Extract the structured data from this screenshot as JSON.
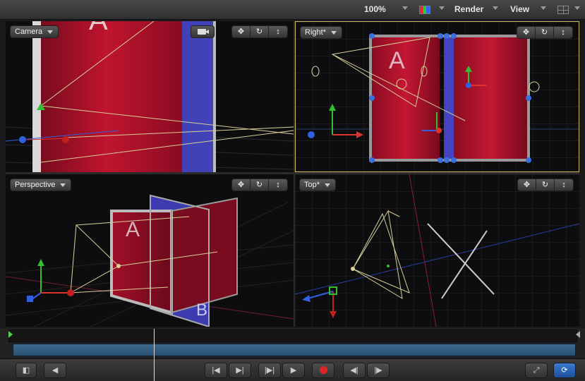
{
  "toolbar": {
    "zoom": "100%",
    "render_label": "Render",
    "view_label": "View",
    "icons": [
      "color-channels-icon",
      "layout-icon"
    ]
  },
  "viewports": {
    "camera": {
      "label": "Camera",
      "tools": [
        "pan-icon",
        "orbit-icon",
        "dolly-icon"
      ]
    },
    "right": {
      "label": "Right*",
      "tools": [
        "pan-icon",
        "orbit-icon",
        "dolly-icon"
      ]
    },
    "perspective": {
      "label": "Perspective",
      "tools": [
        "pan-icon",
        "orbit-icon",
        "dolly-icon"
      ]
    },
    "top": {
      "label": "Top*",
      "tools": [
        "pan-icon",
        "orbit-icon",
        "dolly-icon"
      ]
    }
  },
  "scene_text": {
    "layer_a": "A",
    "layer_b": "B"
  },
  "transport": {
    "buttons": [
      "show-timing-icon",
      "mute-icon",
      "go-to-start-icon",
      "go-to-end-icon",
      "step-icon",
      "play-icon",
      "record-icon",
      "prev-frame-icon",
      "next-frame-icon",
      "fullscreen-icon",
      "loop-icon"
    ]
  },
  "colors": {
    "layer_red": "#b0102c",
    "layer_blue": "#3a3aa8",
    "axis_x": "#e03030",
    "axis_y": "#30c030",
    "axis_z": "#3060e0",
    "selection": "#c9b860",
    "handle": "#3a6fe0"
  }
}
